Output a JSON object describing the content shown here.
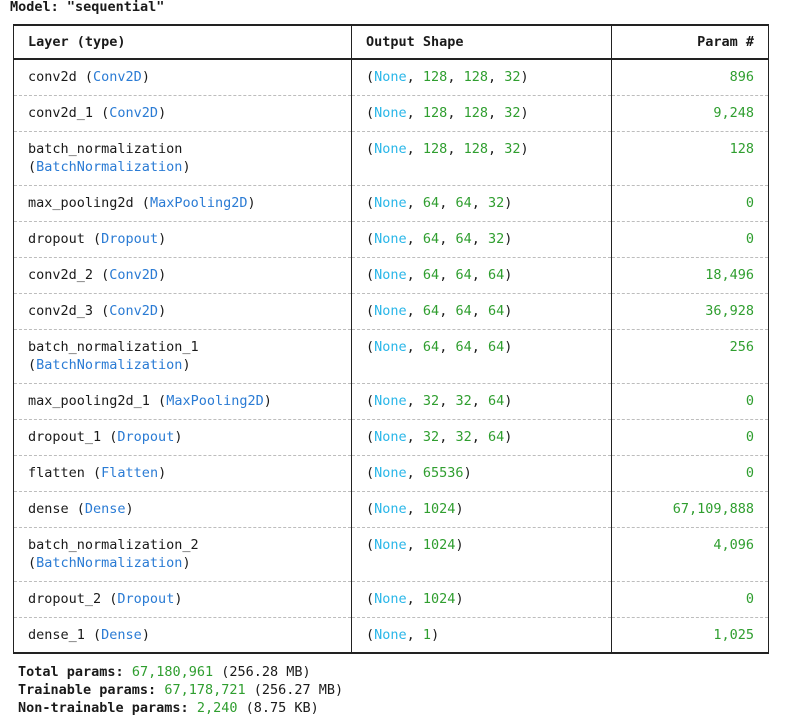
{
  "model_label": "Model: \"sequential\"",
  "headers": {
    "layer": "Layer (type)",
    "output_shape": "Output Shape",
    "params": "Param #"
  },
  "layers": [
    {
      "name": "conv2d",
      "type": "Conv2D",
      "shape": [
        "128",
        "128",
        "32"
      ],
      "params": "896"
    },
    {
      "name": "conv2d_1",
      "type": "Conv2D",
      "shape": [
        "128",
        "128",
        "32"
      ],
      "params": "9,248"
    },
    {
      "name": "batch_normalization",
      "type": "BatchNormalization",
      "shape": [
        "128",
        "128",
        "32"
      ],
      "params": "128",
      "wrap": true
    },
    {
      "name": "max_pooling2d",
      "type": "MaxPooling2D",
      "shape": [
        "64",
        "64",
        "32"
      ],
      "params": "0"
    },
    {
      "name": "dropout",
      "type": "Dropout",
      "shape": [
        "64",
        "64",
        "32"
      ],
      "params": "0"
    },
    {
      "name": "conv2d_2",
      "type": "Conv2D",
      "shape": [
        "64",
        "64",
        "64"
      ],
      "params": "18,496"
    },
    {
      "name": "conv2d_3",
      "type": "Conv2D",
      "shape": [
        "64",
        "64",
        "64"
      ],
      "params": "36,928"
    },
    {
      "name": "batch_normalization_1",
      "type": "BatchNormalization",
      "shape": [
        "64",
        "64",
        "64"
      ],
      "params": "256",
      "wrap": true
    },
    {
      "name": "max_pooling2d_1",
      "type": "MaxPooling2D",
      "shape": [
        "32",
        "32",
        "64"
      ],
      "params": "0"
    },
    {
      "name": "dropout_1",
      "type": "Dropout",
      "shape": [
        "32",
        "32",
        "64"
      ],
      "params": "0"
    },
    {
      "name": "flatten",
      "type": "Flatten",
      "shape": [
        "65536"
      ],
      "params": "0"
    },
    {
      "name": "dense",
      "type": "Dense",
      "shape": [
        "1024"
      ],
      "params": "67,109,888"
    },
    {
      "name": "batch_normalization_2",
      "type": "BatchNormalization",
      "shape": [
        "1024"
      ],
      "params": "4,096",
      "wrap": true
    },
    {
      "name": "dropout_2",
      "type": "Dropout",
      "shape": [
        "1024"
      ],
      "params": "0"
    },
    {
      "name": "dense_1",
      "type": "Dense",
      "shape": [
        "1"
      ],
      "params": "1,025"
    }
  ],
  "none_keyword": "None",
  "totals": [
    {
      "label": "Total params:",
      "count": "67,180,961",
      "size": "(256.28 MB)"
    },
    {
      "label": "Trainable params:",
      "count": "67,178,721",
      "size": "(256.27 MB)"
    },
    {
      "label": "Non-trainable params:",
      "count": "2,240",
      "size": "(8.75 KB)"
    }
  ]
}
